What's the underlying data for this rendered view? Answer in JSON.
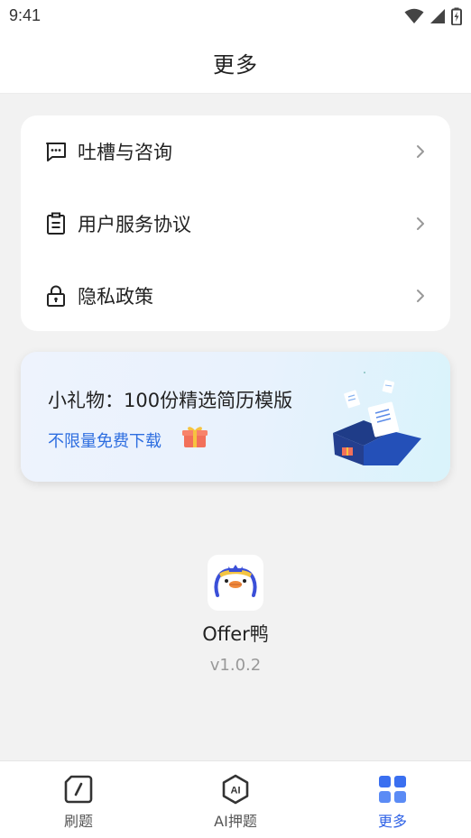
{
  "status_bar": {
    "time": "9:41"
  },
  "header": {
    "title": "更多"
  },
  "menu": {
    "items": [
      {
        "label": "吐槽与咨询",
        "icon": "chat-bubble-icon"
      },
      {
        "label": "用户服务协议",
        "icon": "clipboard-icon"
      },
      {
        "label": "隐私政策",
        "icon": "lock-icon"
      }
    ]
  },
  "gift_banner": {
    "title": "小礼物：100份精选简历模版",
    "subtitle": "不限量免费下载",
    "accent_color": "#2e6ee0"
  },
  "app_info": {
    "name": "Offer鸭",
    "version": "v1.0.2"
  },
  "tabbar": {
    "tabs": [
      {
        "label": "刷题",
        "icon": "brush-slash-icon",
        "active": false
      },
      {
        "label": "AI押题",
        "icon": "ai-hexagon-icon",
        "active": false
      },
      {
        "label": "更多",
        "icon": "grid-icon",
        "active": true
      }
    ],
    "active_color": "#2f62e6"
  }
}
